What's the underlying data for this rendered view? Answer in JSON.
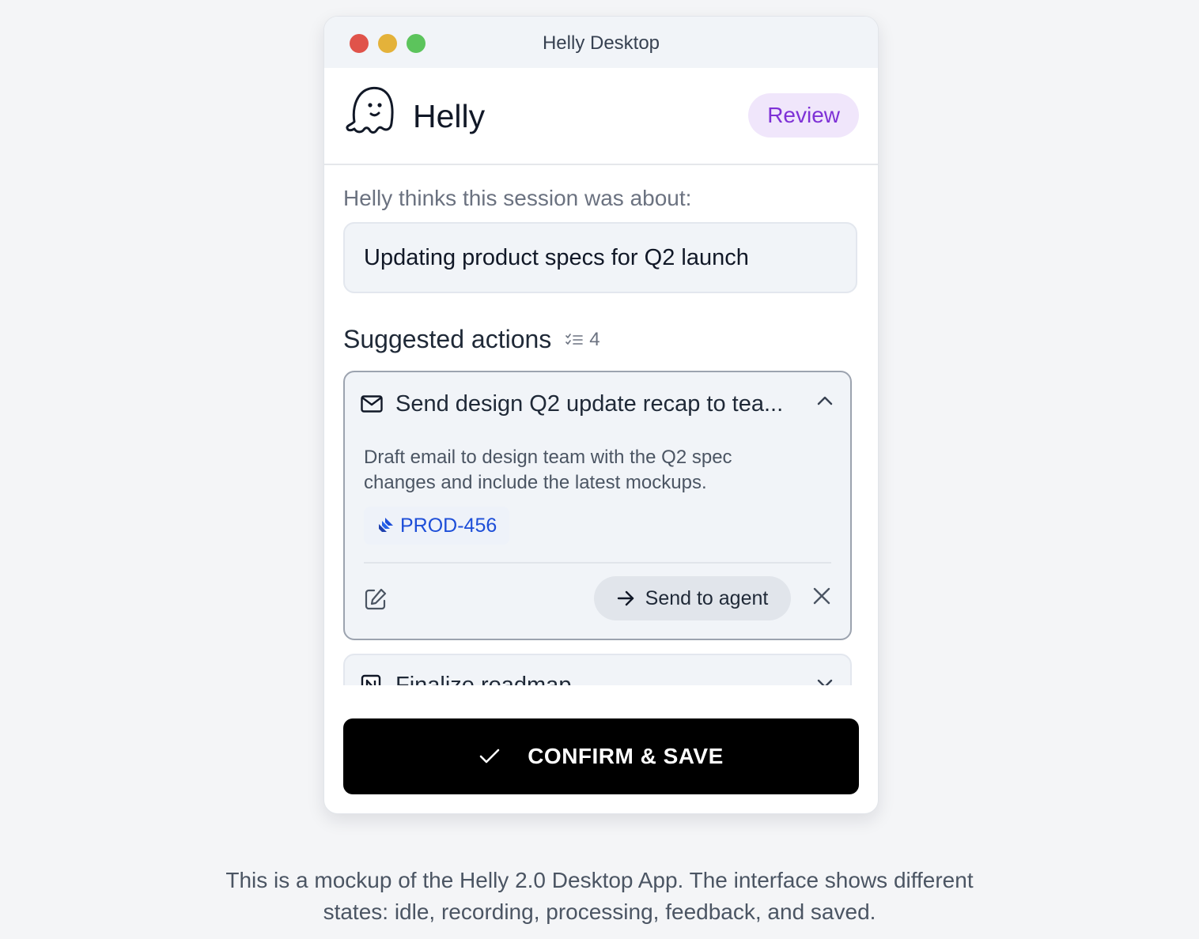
{
  "window": {
    "title": "Helly Desktop"
  },
  "header": {
    "app_name": "Helly",
    "status_badge": "Review"
  },
  "session": {
    "intro": "Helly thinks this session was about:",
    "summary": "Updating product specs for Q2 launch"
  },
  "actions": {
    "section_title": "Suggested actions",
    "count": "4",
    "items": [
      {
        "icon": "mail-icon",
        "title": "Send design Q2 update recap to tea...",
        "description": "Draft email to design team with the Q2 spec changes and include the latest mockups.",
        "ticket": "PROD-456",
        "send_label": "Send to agent",
        "expanded": true
      },
      {
        "icon": "notion-icon",
        "title": "Finalize roadmap",
        "expanded": false
      }
    ]
  },
  "confirm": {
    "label": "CONFIRM & SAVE"
  },
  "caption": "This is a mockup of the Helly 2.0 Desktop App. The interface shows different states: idle, recording, processing, feedback, and saved.",
  "colors": {
    "badge_bg": "#f0e6fb",
    "badge_text": "#7e31d6",
    "ticket_text": "#1d4ed8",
    "confirm_bg": "#000000",
    "traffic_red": "#e0534a",
    "traffic_yellow": "#e4b23a",
    "traffic_green": "#5cc45c"
  }
}
